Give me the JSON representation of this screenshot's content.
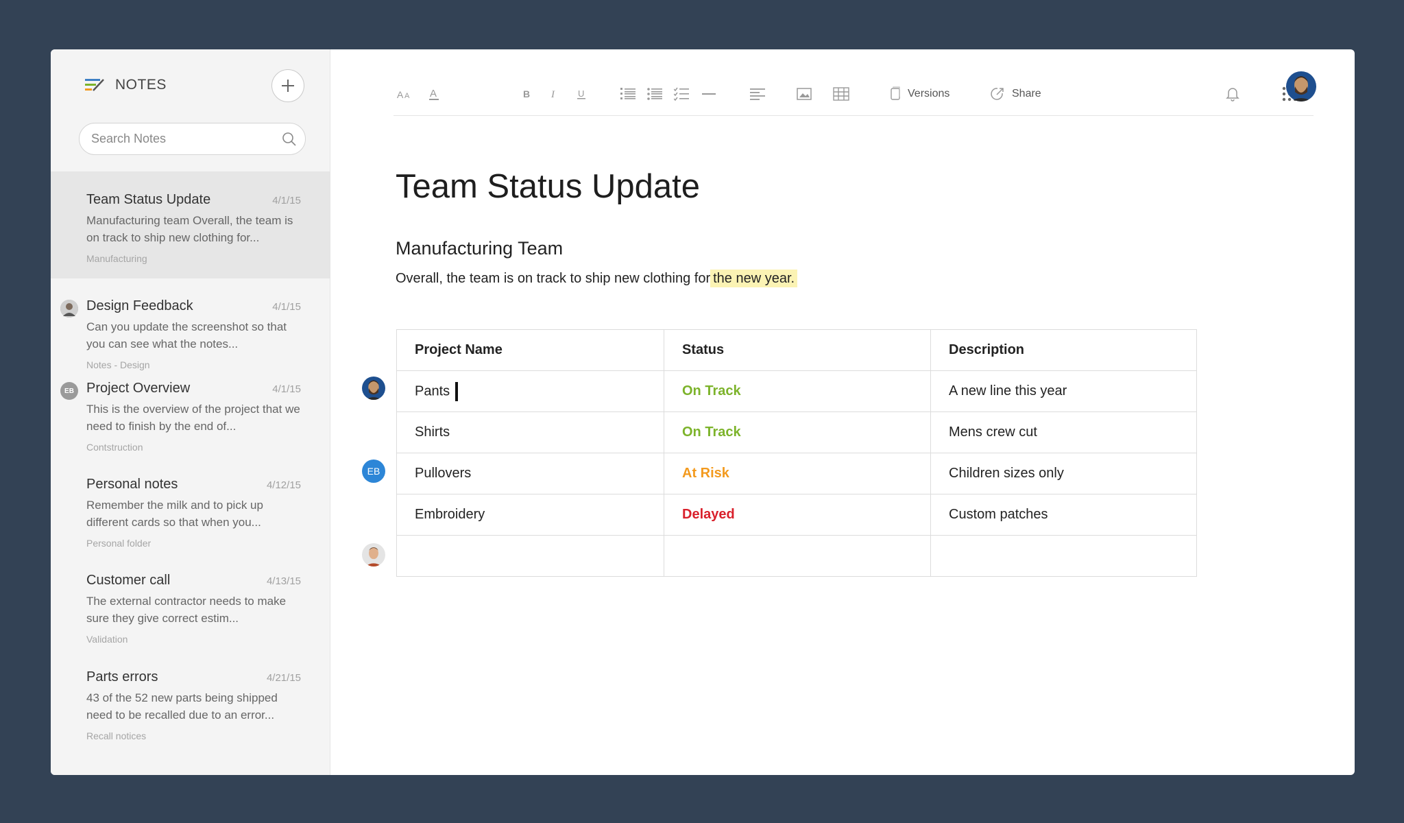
{
  "app": {
    "brand_label": "NOTES"
  },
  "search": {
    "placeholder": "Search Notes"
  },
  "notes": [
    {
      "title": "Team Status Update",
      "date": "4/1/15",
      "snippet": "Manufacturing team  Overall, the team is on track to ship new clothing for...",
      "folder": "Manufacturing",
      "selected": true
    },
    {
      "title": "Design Feedback",
      "date": "4/1/15",
      "snippet": "Can you update the screenshot so that you can see what the notes...",
      "folder": "Notes - Design"
    },
    {
      "title": "Project Overview",
      "date": "4/1/15",
      "snippet": "This is the overview of the project that we need to finish by the end of...",
      "folder": "Contstruction",
      "avatar_initials": "EB"
    },
    {
      "title": "Personal notes",
      "date": "4/12/15",
      "snippet": "Remember the milk and to pick up different cards so that when you...",
      "folder": "Personal folder"
    },
    {
      "title": "Customer call",
      "date": "4/13/15",
      "snippet": "The external contractor needs to make sure they give correct estim...",
      "folder": "Validation"
    },
    {
      "title": "Parts errors",
      "date": "4/21/15",
      "snippet": "43 of the 52 new parts being shipped need to be recalled due to an error...",
      "folder": "Recall notices"
    }
  ],
  "toolbar": {
    "versions_label": "Versions",
    "share_label": "Share",
    "icons": [
      "font-size-icon",
      "text-color-icon",
      "bold-icon",
      "italic-icon",
      "underline-icon",
      "numbered-list-icon",
      "bulleted-list-icon",
      "checklist-icon",
      "horizontal-rule-icon",
      "align-left-icon",
      "image-icon",
      "table-icon",
      "versions-icon",
      "share-icon",
      "bell-icon",
      "apps-grid-icon"
    ]
  },
  "document": {
    "title": "Team Status Update",
    "subtitle": "Manufacturing Team",
    "paragraph_prefix": "Overall, the team is on track to ship new clothing for",
    "paragraph_highlight": "the new year.",
    "table": {
      "headers": [
        "Project Name",
        "Status",
        "Description"
      ],
      "rows": [
        {
          "project": "Pants",
          "status": "On Track",
          "description": "A new line this year"
        },
        {
          "project": "Shirts",
          "status": "On Track",
          "description": "Mens crew cut"
        },
        {
          "project": "Pullovers",
          "status": "At Risk",
          "description": "Children sizes only"
        },
        {
          "project": "Embroidery",
          "status": "Delayed",
          "description": "Custom patches"
        },
        {
          "project": "",
          "status": "",
          "description": ""
        }
      ]
    },
    "collaborator_initials": "EB"
  },
  "colors": {
    "background": "#334255",
    "on_track": "#7cb32a",
    "at_risk": "#f39a1e",
    "delayed": "#d9202b",
    "highlight": "#fbf3b4",
    "avatar_blue": "#2d86d7"
  }
}
